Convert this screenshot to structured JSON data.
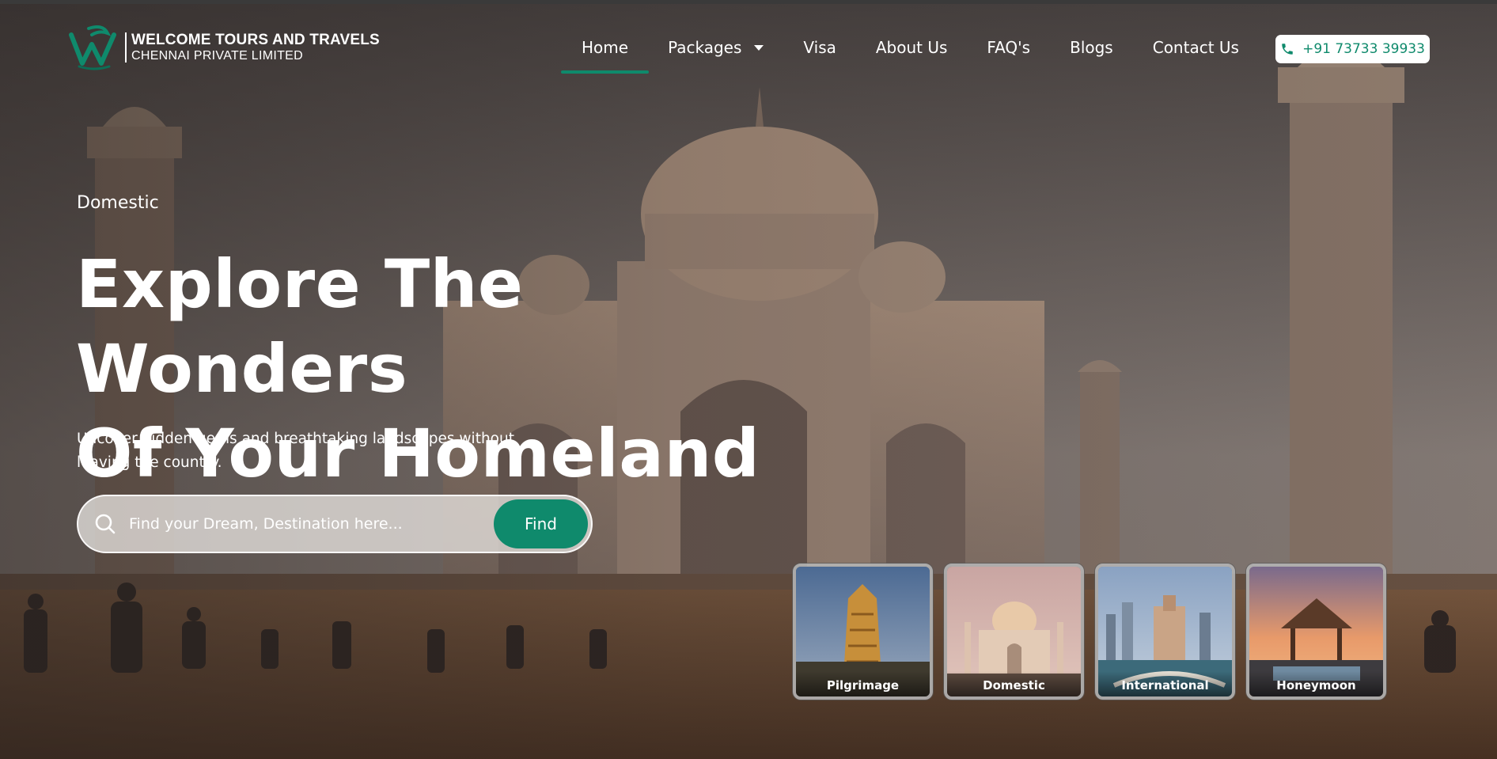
{
  "brand": {
    "name": "WELCOME TOURS AND TRAVELS",
    "subtitle": "CHENNAI PRIVATE LIMITED",
    "logo_icon": "wt-monogram-logo",
    "accent_color": "#0f8a6c"
  },
  "nav": {
    "items": [
      {
        "label": "Home",
        "active": true
      },
      {
        "label": "Packages",
        "has_dropdown": true
      },
      {
        "label": "Visa"
      },
      {
        "label": "About Us"
      },
      {
        "label": "FAQ's"
      },
      {
        "label": "Blogs"
      },
      {
        "label": "Contact Us"
      }
    ],
    "phone": {
      "label": "+91 73733 39933",
      "icon": "phone-icon"
    }
  },
  "hero": {
    "eyebrow": "Domestic",
    "headline_line1": "Explore The Wonders",
    "headline_line2": "Of Your Homeland",
    "subtitle": "Uncover hidden gems and breathtaking landscapes without leaving the country.",
    "background": "taj-mahal-photo"
  },
  "search": {
    "placeholder": "Find your Dream, Destination here...",
    "value": "",
    "button_label": "Find",
    "icon": "search-icon"
  },
  "categories": [
    {
      "label": "Pilgrimage",
      "image": "temple-gopuram"
    },
    {
      "label": "Domestic",
      "image": "taj-mahal"
    },
    {
      "label": "International",
      "image": "city-skyline"
    },
    {
      "label": "Honeymoon",
      "image": "sunset-pavilion"
    }
  ]
}
